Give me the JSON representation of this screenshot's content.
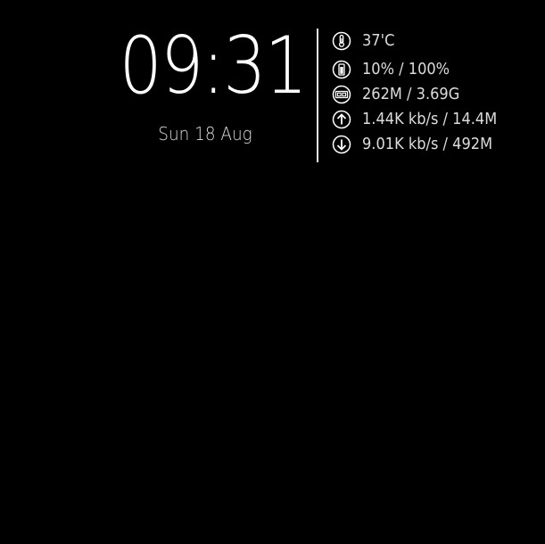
{
  "clock": {
    "time": "09:31",
    "date": "Sun 18 Aug"
  },
  "stats": {
    "temperature": {
      "icon": "thermometer-icon",
      "value": "37'C"
    },
    "cpu": {
      "icon": "battery-icon",
      "value": "10% / 100%"
    },
    "memory": {
      "icon": "memory-chip-icon",
      "value": "262M / 3.69G"
    },
    "upload": {
      "icon": "arrow-up-circle-icon",
      "value": "1.44K kb/s / 14.4M"
    },
    "download": {
      "icon": "arrow-down-circle-icon",
      "value": "9.01K kb/s / 492M"
    }
  },
  "colors": {
    "background": "#000000",
    "foreground": "#ffffff",
    "text_dim": "#dcdcdc"
  }
}
